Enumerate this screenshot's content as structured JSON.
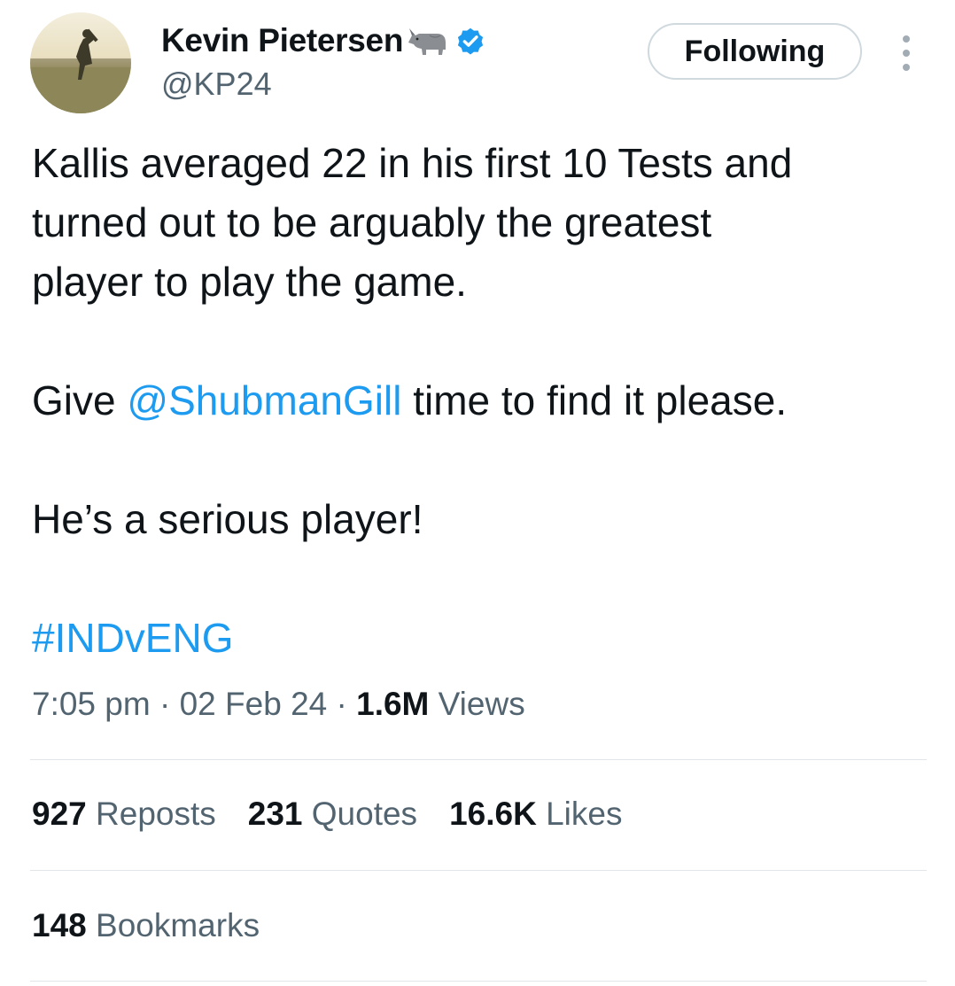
{
  "author": {
    "display_name": "Kevin Pietersen",
    "handle": "@KP24",
    "name_emoji": "rhino-emoji",
    "verified_icon": "verified-badge-icon",
    "verified_color": "#1d9bf0"
  },
  "follow_button": {
    "label": "Following"
  },
  "more_menu": {
    "icon": "more-vertical-icon"
  },
  "tweet": {
    "line1": "Kallis averaged 22 in his first 10 Tests and",
    "line2": "turned out to be arguably the greatest",
    "line3": "player to play the game.",
    "para2_before": "Give ",
    "mention": "@ShubmanGill",
    "para2_after": " time to find it please.",
    "para3": "He’s a serious player!",
    "hashtag": "#INDvENG"
  },
  "meta": {
    "time": "7:05 pm",
    "separator": "·",
    "date": "02 Feb 24",
    "views_count": "1.6M",
    "views_label": "Views"
  },
  "stats": {
    "reposts_count": "927",
    "reposts_label": "Reposts",
    "quotes_count": "231",
    "quotes_label": "Quotes",
    "likes_count": "16.6K",
    "likes_label": "Likes",
    "bookmarks_count": "148",
    "bookmarks_label": "Bookmarks"
  },
  "colors": {
    "link": "#1d9bf0",
    "text_primary": "#0f1419",
    "text_secondary": "#536471",
    "divider": "#e1e6ea",
    "button_border": "#cfd9de"
  }
}
